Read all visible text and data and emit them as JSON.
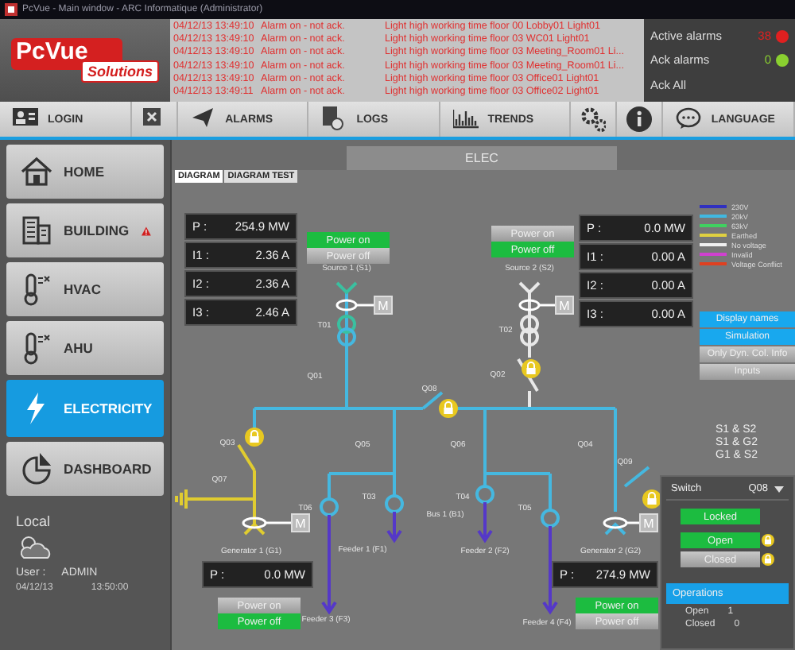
{
  "window": {
    "title": "PcVue - Main window - ARC Informatique (Administrator)"
  },
  "logo": {
    "name": "PcVue",
    "tagline": "Solutions"
  },
  "alarms": [
    {
      "date": "04/12/13 13:49:10",
      "status": "Alarm on - not ack.",
      "message": "Light high working time floor 00 Lobby01 Light01"
    },
    {
      "date": "04/12/13 13:49:10",
      "status": "Alarm on - not ack.",
      "message": "Light high working time floor 03 WC01 Light01"
    },
    {
      "date": "04/12/13 13:49:10",
      "status": "Alarm on - not ack.",
      "message": "Light high working time floor 03 Meeting_Room01 Li..."
    },
    {
      "date": "04/12/13 13:49:10",
      "status": "Alarm on - not ack.",
      "message": "Light high working time floor 03 Meeting_Room01 Li..."
    },
    {
      "date": "04/12/13 13:49:10",
      "status": "Alarm on - not ack.",
      "message": "Light high working time floor 03 Office01 Light01"
    },
    {
      "date": "04/12/13 13:49:11",
      "status": "Alarm on - not ack.",
      "message": "Light high working time floor 03 Office02 Light01"
    }
  ],
  "alarm_summary": [
    {
      "label": "Active alarms",
      "count": "38",
      "color": "#e02020"
    },
    {
      "label": "Ack alarms",
      "count": "0",
      "color": "#8ad030"
    },
    {
      "label": "Ack All"
    }
  ],
  "toolbar": [
    {
      "kind": "login",
      "label": "LOGIN"
    },
    {
      "kind": "close"
    },
    {
      "kind": "alarms",
      "label": "ALARMS"
    },
    {
      "kind": "logs",
      "label": "LOGS"
    },
    {
      "kind": "trends",
      "label": "TRENDS"
    },
    {
      "kind": "settings"
    },
    {
      "kind": "info"
    },
    {
      "kind": "language",
      "label": "LANGUAGE"
    }
  ],
  "sidebar": {
    "items": [
      {
        "kind": "home",
        "label": "HOME",
        "selected": false,
        "warning": false
      },
      {
        "kind": "building",
        "label": "BUILDING",
        "selected": false,
        "warning": true
      },
      {
        "kind": "hvac",
        "label": "HVAC",
        "selected": false,
        "warning": false
      },
      {
        "kind": "ahu",
        "label": "AHU",
        "selected": false,
        "warning": false
      },
      {
        "kind": "electricity",
        "label": "ELECTRICITY",
        "selected": true,
        "warning": false
      },
      {
        "kind": "dashboard",
        "label": "DASHBOARD",
        "selected": false,
        "warning": false
      }
    ],
    "location": "Local",
    "user_label": "User :",
    "user": "ADMIN",
    "date": "04/12/13",
    "time": "13:50:00"
  },
  "view": {
    "title": "ELEC",
    "tabs": [
      {
        "label": "DIAGRAM",
        "selected": true
      },
      {
        "label": "DIAGRAM TEST",
        "selected": false
      }
    ]
  },
  "meters": [
    {
      "rows": [
        {
          "label": "P :",
          "value": "254.9 MW"
        },
        {
          "label": "I1 :",
          "value": "2.36 A"
        },
        {
          "label": "I2 :",
          "value": "2.36 A"
        },
        {
          "label": "I3 :",
          "value": "2.46 A"
        }
      ]
    },
    {
      "rows": [
        {
          "label": "P :",
          "value": "0.0 MW"
        },
        {
          "label": "I1 :",
          "value": "0.00 A"
        },
        {
          "label": "I2 :",
          "value": "0.00 A"
        },
        {
          "label": "I3 :",
          "value": "0.00 A"
        }
      ]
    },
    {
      "rows": [
        {
          "label": "P :",
          "value": "0.0 MW"
        }
      ]
    },
    {
      "rows": [
        {
          "label": "P :",
          "value": "274.9 MW"
        }
      ]
    }
  ],
  "power_controls": [
    {
      "buttons": [
        {
          "label": "Power on",
          "selected": true
        },
        {
          "label": "Power off",
          "selected": false
        }
      ]
    },
    {
      "buttons": [
        {
          "label": "Power on",
          "selected": false
        },
        {
          "label": "Power off",
          "selected": true
        }
      ]
    },
    {
      "buttons": [
        {
          "label": "Power on",
          "selected": false
        },
        {
          "label": "Power off",
          "selected": true
        }
      ]
    },
    {
      "buttons": [
        {
          "label": "Power on",
          "selected": true
        },
        {
          "label": "Power off",
          "selected": false
        }
      ]
    }
  ],
  "motor_marks": [
    "M",
    "M",
    "M",
    "M"
  ],
  "diagram_labels": [
    "Source 1 (S1)",
    "Source 2 (S2)",
    "T01",
    "T02",
    "Q01",
    "Q08",
    "Q02",
    "Q03",
    "Q05",
    "Q06",
    "Q04",
    "Q07",
    "T06",
    "T03",
    "T04",
    "T05",
    "Bus 1 (B1)",
    "Q09",
    "Generator 1 (G1)",
    "Feeder 1 (F1)",
    "Feeder 2 (F2)",
    "Generator 2 (G2)",
    "Feeder 3 (F3)",
    "Feeder 4 (F4)"
  ],
  "legend": [
    {
      "label": "230V",
      "color": "#3030c0"
    },
    {
      "label": "20kV",
      "color": "#40b8e0"
    },
    {
      "label": "63kV",
      "color": "#40d060"
    },
    {
      "label": "Earthed",
      "color": "#e0d040"
    },
    {
      "label": "No voltage",
      "color": "#f0f0f0"
    },
    {
      "label": "Invalid",
      "color": "#d040d0"
    },
    {
      "label": "Voltage Conflict",
      "color": "#e04020"
    }
  ],
  "options": [
    {
      "label": "Display names",
      "on": true
    },
    {
      "label": "Simulation",
      "on": true
    },
    {
      "label": "Only Dyn. Col. Info",
      "on": false
    },
    {
      "label": "Inputs",
      "on": false
    }
  ],
  "couplings": [
    "S1 & S2",
    "S1 & G2",
    "G1 & S2"
  ],
  "switch_panel": {
    "label": "Switch",
    "value": "Q08",
    "states": [
      {
        "label": "Locked",
        "active": true,
        "lock": false
      },
      {
        "label": "Open",
        "active": true,
        "lock": true
      },
      {
        "label": "Closed",
        "active": false,
        "lock": true
      }
    ],
    "operations_title": "Operations",
    "operations": [
      {
        "label": "Open",
        "count": "1"
      },
      {
        "label": "Closed",
        "count": "0"
      }
    ]
  }
}
